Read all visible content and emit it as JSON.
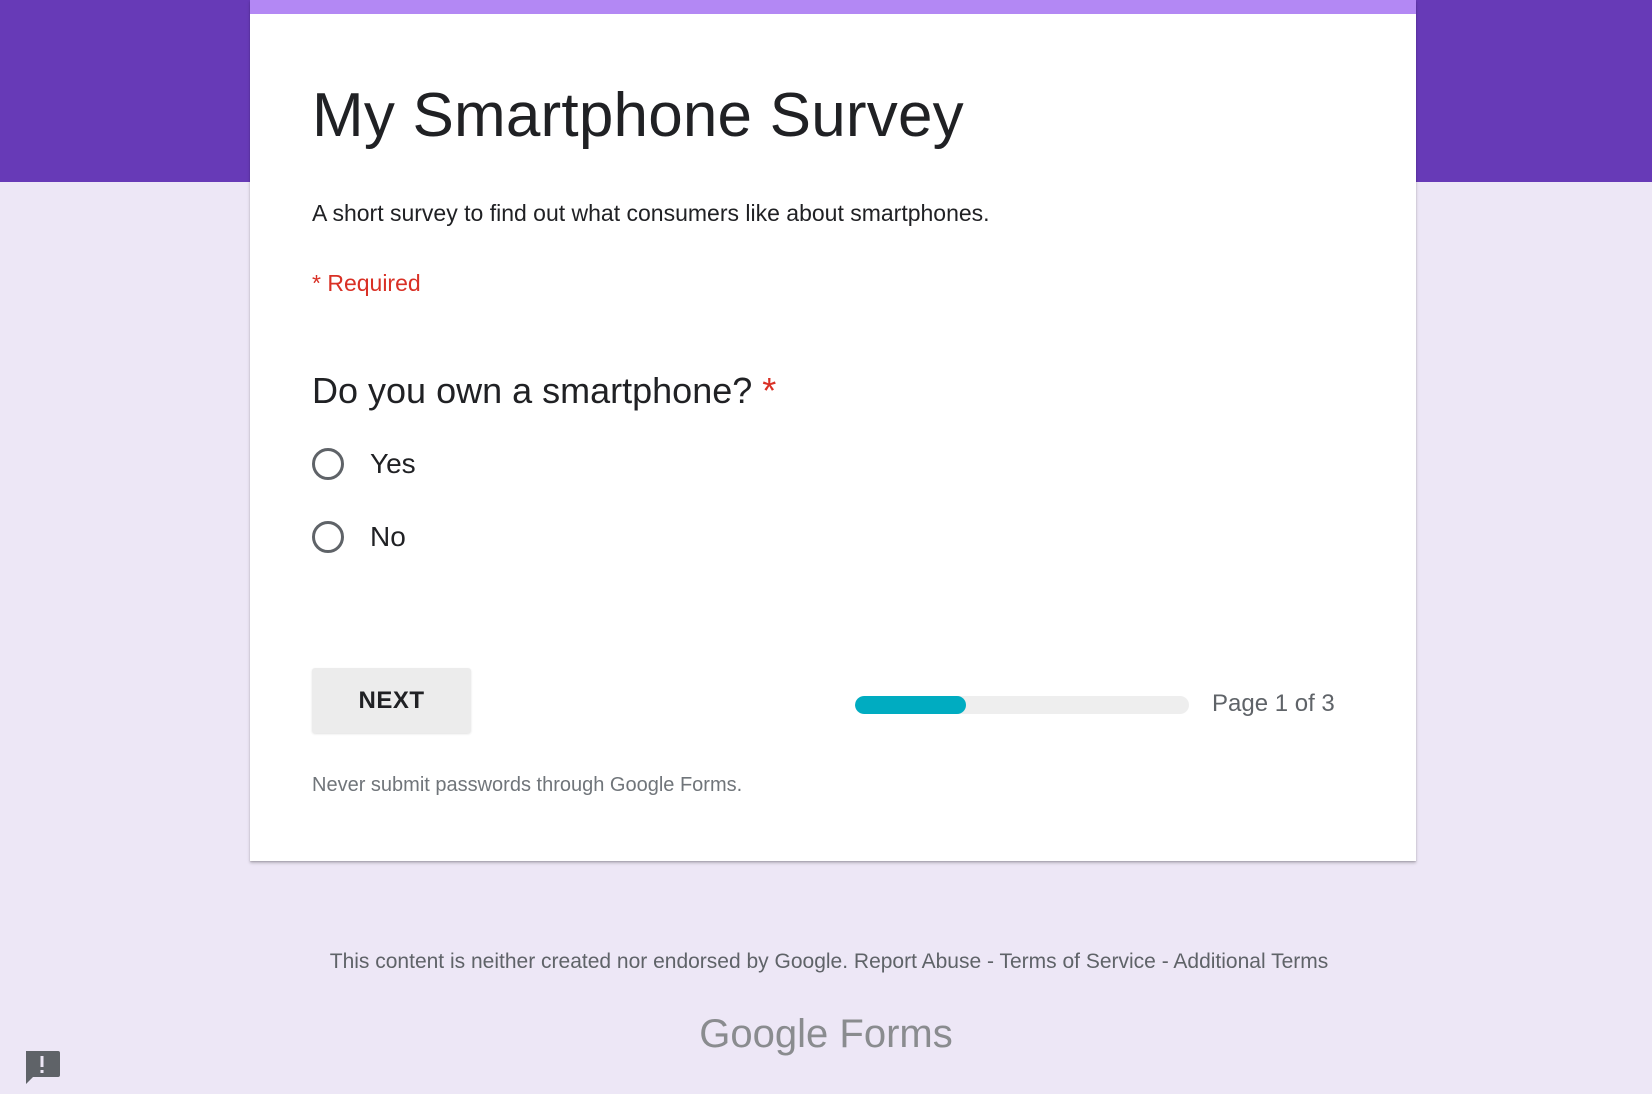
{
  "colors": {
    "theme": "#673ab7",
    "accent_stripe": "#b388f4",
    "background": "#ede7f6",
    "progress": "#00acc1",
    "required": "#d93025"
  },
  "form": {
    "title": "My Smartphone Survey",
    "description": "A short survey to find out what consumers like about smartphones.",
    "required_note": "* Required"
  },
  "question": {
    "text": "Do you own a smartphone?",
    "required_marker": "*",
    "options": [
      {
        "label": "Yes",
        "selected": false
      },
      {
        "label": "No",
        "selected": false
      }
    ]
  },
  "navigation": {
    "next_label": "NEXT",
    "page_text": "Page 1 of 3",
    "current_page": 1,
    "total_pages": 3
  },
  "password_warning": "Never submit passwords through Google Forms.",
  "footer": {
    "disclaimer": "This content is neither created nor endorsed by Google.",
    "report_abuse": "Report Abuse",
    "separator": "-",
    "terms_of_service": "Terms of Service",
    "additional_terms": "Additional Terms"
  },
  "brand": {
    "google": "Google",
    "forms": "Forms"
  },
  "icons": {
    "feedback": "feedback-icon",
    "radio": "radio-unchecked-icon"
  }
}
